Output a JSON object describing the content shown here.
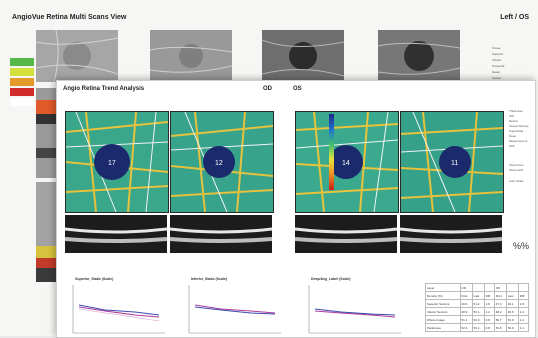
{
  "back_window": {
    "title": "AngioVue Retina Multi Scans View",
    "eye": "Left / OS",
    "legend_colors": [
      "#57b947",
      "#d6e03c",
      "#e59b2b",
      "#d22b2b",
      "#ffffff"
    ],
    "options": [
      "Fovea",
      "Superior",
      "Inferior",
      "Temporal",
      "Nasal",
      "Vessel",
      "Perfusion"
    ]
  },
  "front_window": {
    "title": "Angio Retina Trend Analysis",
    "od_label": "OD",
    "os_label": "OS",
    "scans": [
      {
        "fovea_value": "17"
      },
      {
        "fovea_value": "12"
      },
      {
        "fovea_value": "14"
      },
      {
        "fovea_value": "11"
      }
    ],
    "side_options": [
      "Thickness",
      "ILM",
      "Retina",
      "Vessel Density",
      "Superficial",
      "Deep",
      "Measurement",
      "FAZ",
      "Show lines",
      "Show Grid",
      "Auto Scale"
    ],
    "pct_symbol": "%%",
    "graphs": [
      {
        "title": "Superior_Static (Scale)"
      },
      {
        "title": "Inferior_Static (Scale)"
      },
      {
        "title": "Deep/Avg_Label (Scale)"
      }
    ],
    "table": {
      "header": [
        "Layer",
        "OD",
        "",
        "",
        "OS",
        "",
        ""
      ],
      "rows": [
        [
          "Density (%)",
          "First",
          "Last",
          "Diff",
          "First",
          "Last",
          "Diff"
        ],
        [
          "Superior Sectors",
          "49.6",
          "51.2",
          "1.6",
          "47.3",
          "49.1",
          "1.8"
        ],
        [
          "Inferior Sectors",
          "48.9",
          "50.1",
          "1.2",
          "48.2",
          "49.6",
          "1.4"
        ],
        [
          "Whole Image",
          "51.2",
          "52.0",
          "0.8",
          "50.7",
          "51.9",
          "1.2"
        ],
        [
          "Parafovea",
          "52.3",
          "53.1",
          "0.8",
          "51.8",
          "52.9",
          "1.1"
        ]
      ]
    }
  }
}
